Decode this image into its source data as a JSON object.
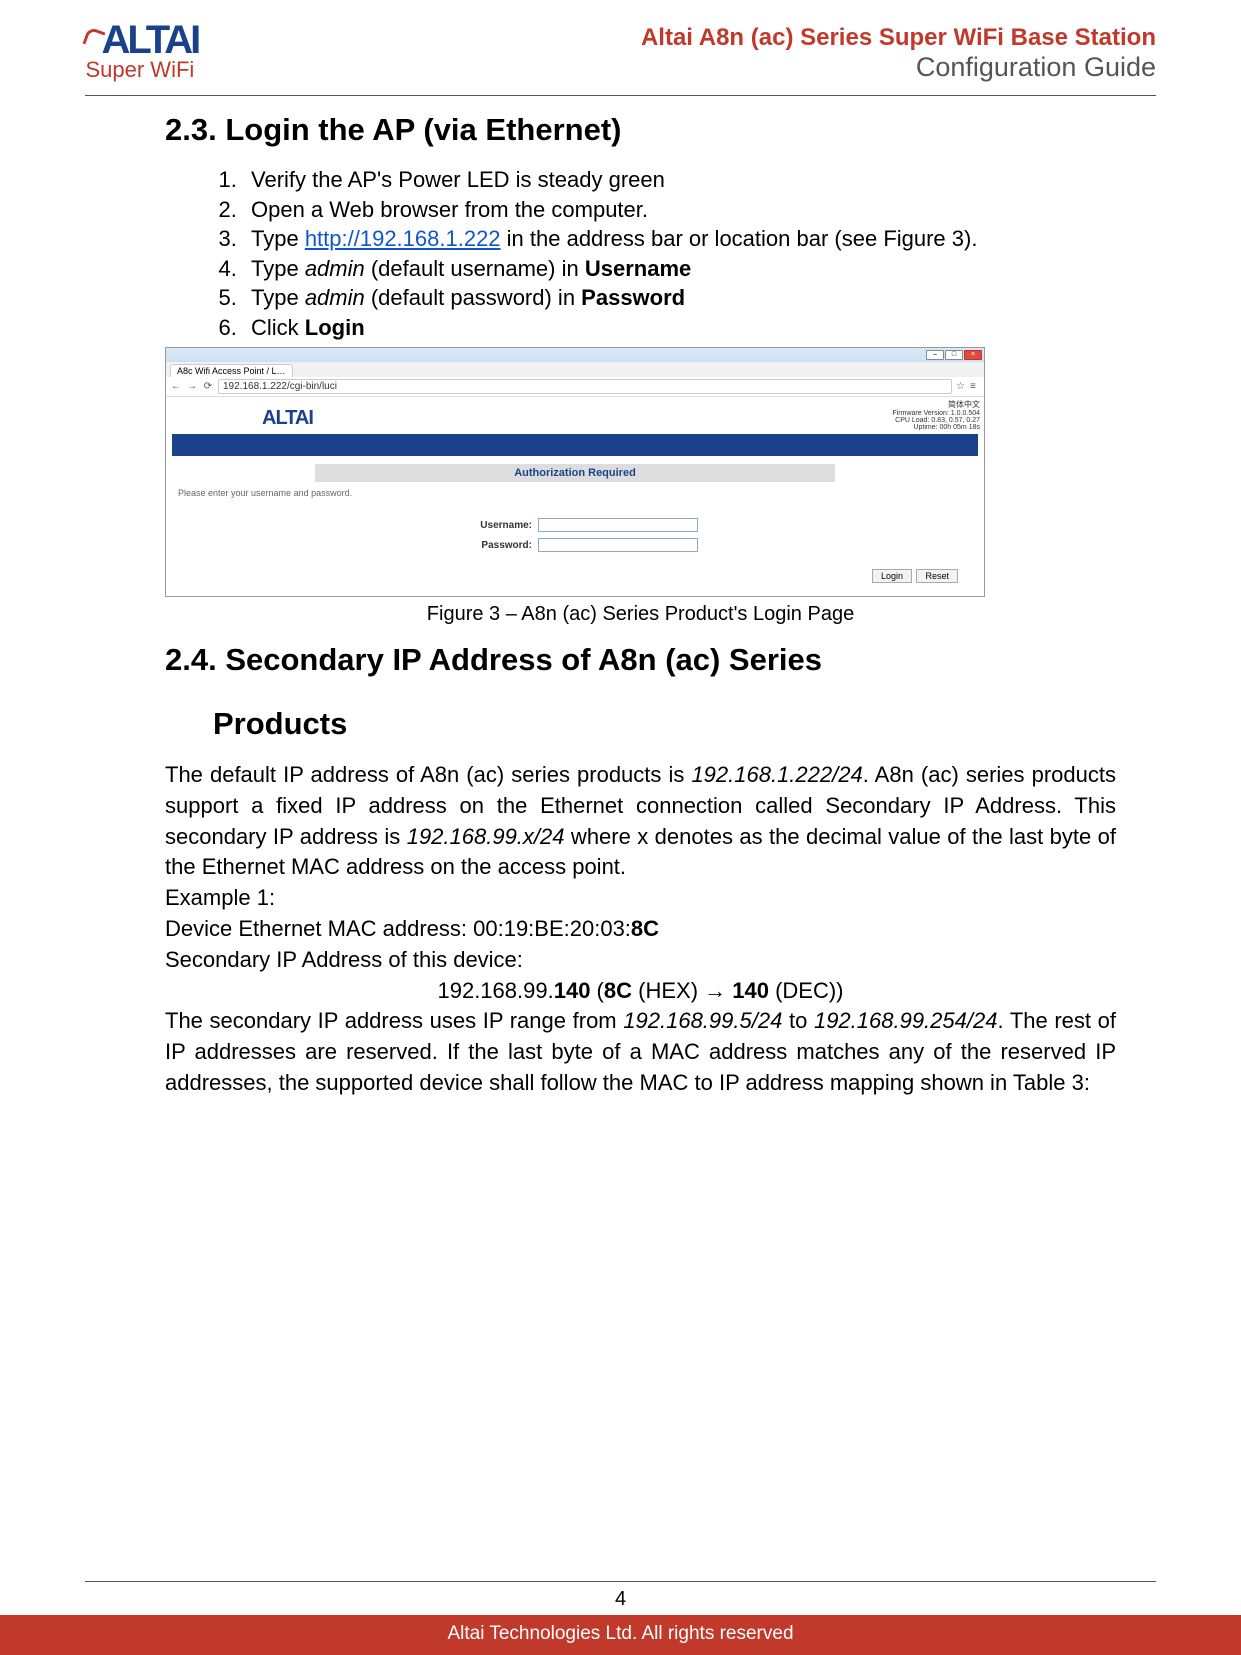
{
  "header": {
    "logo_main": "ALTAI",
    "logo_sub": "Super WiFi",
    "title": "Altai A8n (ac) Series Super WiFi Base Station",
    "subtitle": "Configuration Guide"
  },
  "sec23": {
    "heading": "2.3.  Login the AP (via Ethernet)",
    "steps": {
      "s1": "Verify the AP's Power LED is steady green",
      "s2": "Open a Web browser from the computer.",
      "s3_a": "Type ",
      "s3_url": "http://192.168.1.222",
      "s3_b": " in the address bar or location bar (see Figure 3).",
      "s4_a": "Type ",
      "s4_i": "admin",
      "s4_b": " (default username) in ",
      "s4_bold": "Username",
      "s5_a": "Type ",
      "s5_i": "admin",
      "s5_b": " (default password) in ",
      "s5_bold": "Password",
      "s6_a": "Click ",
      "s6_bold": "Login"
    }
  },
  "shot": {
    "tab_title": "A8c Wifi Access Point / L…",
    "url": "192.168.1.222/cgi-bin/luci",
    "inner_logo": "ALTAI",
    "language": "简体中文",
    "fw": "Firmware Version: 1.0.0.504",
    "cpu": "CPU Load: 0.83, 0.57, 0.27",
    "uptime": "Uptime: 00h 05m 18s",
    "auth_title": "Authorization Required",
    "please": "Please enter your username and password.",
    "user_label": "Username:",
    "pass_label": "Password:",
    "login_btn": "Login",
    "reset_btn": "Reset"
  },
  "fig_caption": "Figure 3 – A8n (ac) Series Product's Login Page",
  "sec24": {
    "heading_a": "2.4.  Secondary IP Address of A8n (ac) Series",
    "heading_b": "Products",
    "p1_a": "The default IP address of A8n (ac) series products is ",
    "p1_i1": "192.168.1.222/24",
    "p1_b": ". A8n (ac) series products support a fixed IP address on the Ethernet connection called Secondary IP Address. This secondary IP address is ",
    "p1_i2": "192.168.99.x/24",
    "p1_c": " where x denotes as the decimal value of the last byte of the Ethernet MAC address on the access point.",
    "ex_label": "Example 1:",
    "ex_mac_a": "Device Ethernet MAC address: 00:19:BE:20:03:",
    "ex_mac_b": "8C",
    "ex_sec": "Secondary IP Address of this device:",
    "ex_calc_a": "192.168.99.",
    "ex_calc_b": "140",
    "ex_calc_c": " (",
    "ex_calc_d": "8C",
    "ex_calc_e": " (HEX) → ",
    "ex_calc_f": "140",
    "ex_calc_g": " (DEC))",
    "p2_a": "The secondary IP address uses IP range from ",
    "p2_i1": "192.168.99.5/24",
    "p2_b": " to ",
    "p2_i2": "192.168.99.254/24",
    "p2_c": ". The rest of IP addresses are reserved. If the last byte of a MAC address matches any of the reserved IP addresses, the supported device shall follow the MAC to IP address mapping shown in Table 3:"
  },
  "footer": {
    "page": "4",
    "text": "Altai Technologies Ltd. All rights reserved"
  }
}
